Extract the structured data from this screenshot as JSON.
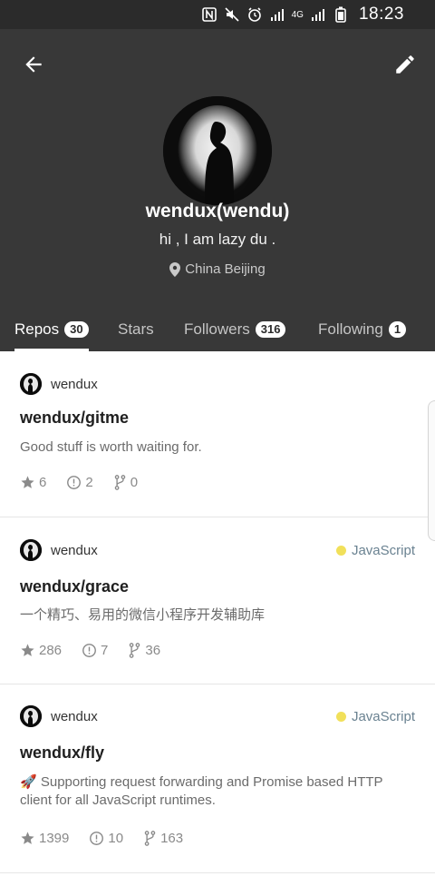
{
  "status_bar": {
    "time": "18:23",
    "network": "4G"
  },
  "profile": {
    "username": "wendux(wendu)",
    "bio": "hi , I am lazy du .",
    "location": "China Beijing"
  },
  "tabs": [
    {
      "label": "Repos",
      "count": "30"
    },
    {
      "label": "Stars",
      "count": ""
    },
    {
      "label": "Followers",
      "count": "316"
    },
    {
      "label": "Following",
      "count": "1"
    }
  ],
  "repos": [
    {
      "owner": "wendux",
      "language": "",
      "name": "wendux/gitme",
      "description": "Good stuff is worth waiting for.",
      "stars": "6",
      "issues": "2",
      "forks": "0"
    },
    {
      "owner": "wendux",
      "language": "JavaScript",
      "name": "wendux/grace",
      "description": "一个精巧、易用的微信小程序开发辅助库",
      "stars": "286",
      "issues": "7",
      "forks": "36"
    },
    {
      "owner": "wendux",
      "language": "JavaScript",
      "name": "wendux/fly",
      "description": "🚀 Supporting request forwarding and Promise based HTTP client for all JavaScript runtimes.",
      "stars": "1399",
      "issues": "10",
      "forks": "163"
    }
  ],
  "colors": {
    "header_bg": "#383838",
    "status_bg": "#2b2b2b",
    "lang_javascript": "#f1e05a"
  }
}
